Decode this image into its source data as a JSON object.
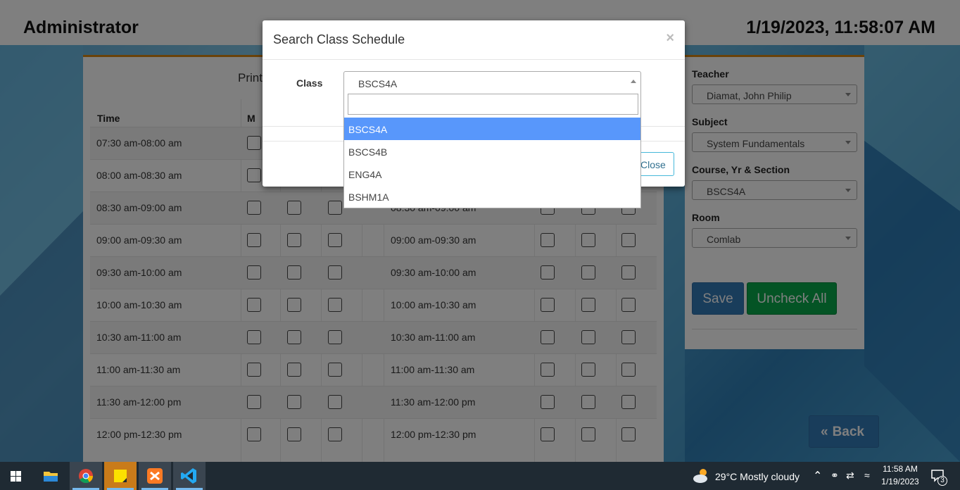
{
  "header": {
    "title": "Administrator",
    "datetime": "1/19/2023, 11:58:07 AM"
  },
  "schedule": {
    "print_heading": "Print",
    "columns": {
      "time": "Time",
      "monday": "M"
    },
    "times": [
      "07:30 am-08:00 am",
      "08:00 am-08:30 am",
      "08:30 am-09:00 am",
      "09:00 am-09:30 am",
      "09:30 am-10:00 am",
      "10:00 am-10:30 am",
      "10:30 am-11:00 am",
      "11:00 am-11:30 am",
      "11:30 am-12:00 pm",
      "12:00 pm-12:30 pm"
    ]
  },
  "form": {
    "teacher_label": "Teacher",
    "teacher_value": "Diamat, John Philip",
    "subject_label": "Subject",
    "subject_value": "System Fundamentals",
    "section_label": "Course, Yr & Section",
    "section_value": "BSCS4A",
    "room_label": "Room",
    "room_value": "Comlab",
    "save_label": "Save",
    "uncheck_label": "Uncheck All",
    "back_label": "Back"
  },
  "modal": {
    "title": "Search Class Schedule",
    "close_x": "×",
    "class_label": "Class",
    "class_value": "BSCS4A",
    "close_button": "Close",
    "options": [
      "BSCS4A",
      "BSCS4B",
      "ENG4A",
      "BSHM1A"
    ],
    "highlighted_option": "BSCS4A"
  },
  "taskbar": {
    "apps": [
      "windows-start",
      "file-explorer",
      "chrome",
      "sticky-notes",
      "xampp",
      "vscode"
    ],
    "active_apps": [
      "chrome",
      "sticky-notes",
      "xampp",
      "vscode"
    ],
    "weather": "29°C  Mostly cloudy",
    "time": "11:58 AM",
    "date": "1/19/2023",
    "notification_count": "3",
    "accent_color": "#76b9ed"
  },
  "colors": {
    "primary": "#337ab7",
    "success": "#08a84a",
    "accent": "#d58512",
    "highlight": "#5897fb"
  }
}
